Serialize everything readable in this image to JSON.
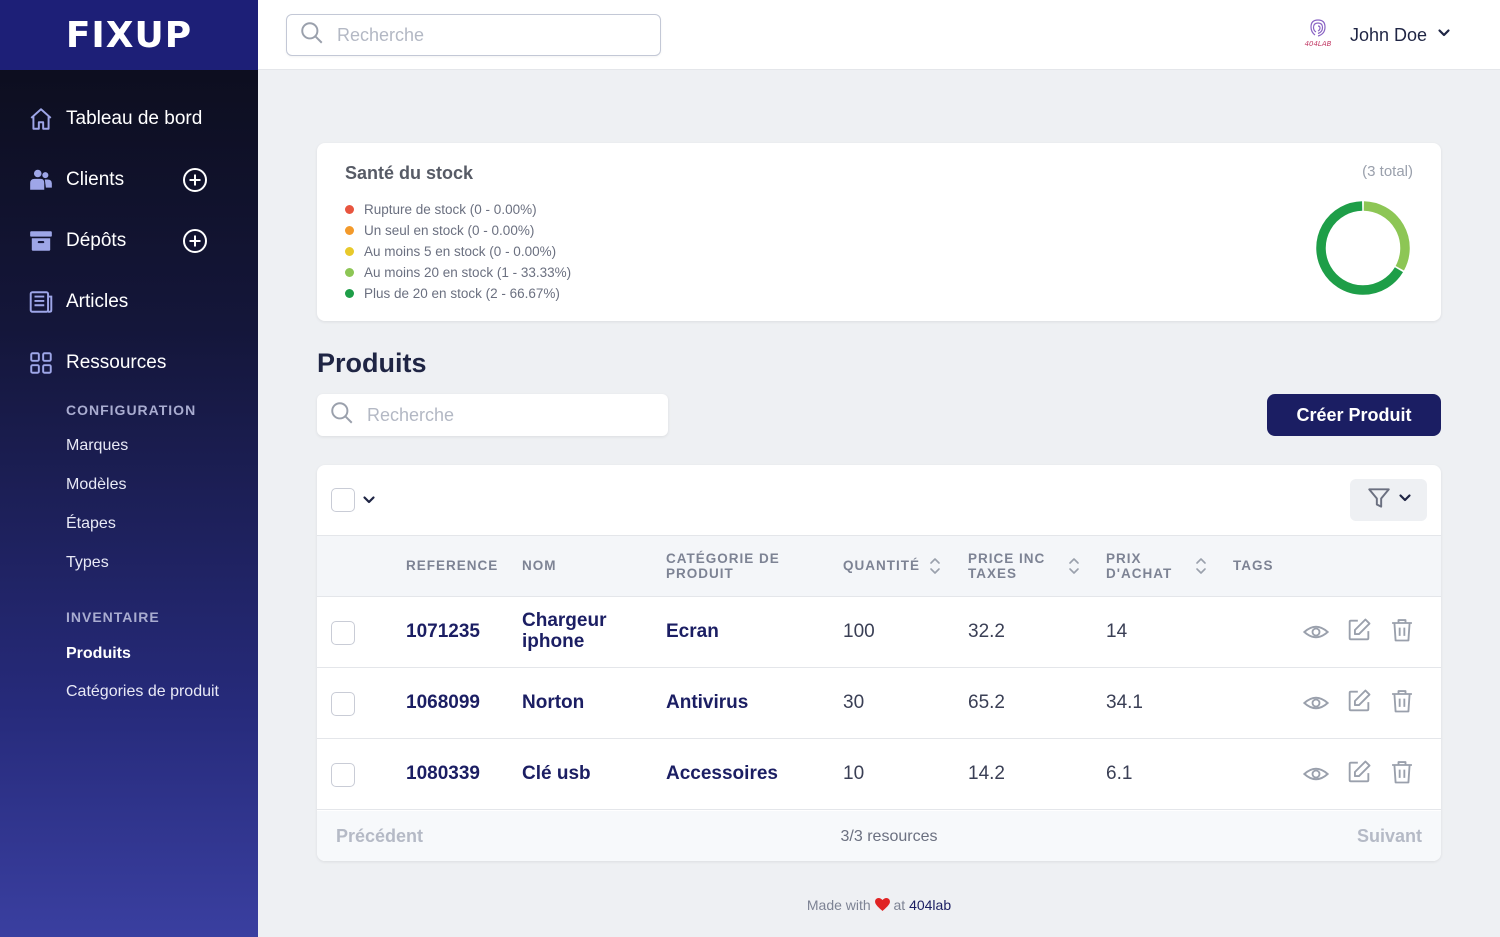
{
  "app": {
    "logo": "FIXUP"
  },
  "sidebar": {
    "items": [
      {
        "label": "Tableau de bord",
        "icon": "home-icon"
      },
      {
        "label": "Clients",
        "icon": "users-icon",
        "has_add": true
      },
      {
        "label": "Dépôts",
        "icon": "archive-icon",
        "has_add": true
      },
      {
        "label": "Articles",
        "icon": "newspaper-icon"
      },
      {
        "label": "Ressources",
        "icon": "grid-icon"
      }
    ],
    "configuration": {
      "heading": "CONFIGURATION",
      "items": [
        "Marques",
        "Modèles",
        "Étapes",
        "Types"
      ]
    },
    "inventaire": {
      "heading": "INVENTAIRE",
      "items": [
        "Produits",
        "Catégories de produit"
      ],
      "active": "Produits"
    }
  },
  "header": {
    "search_placeholder": "Recherche",
    "user_name": "John Doe",
    "avatar_text": "404LAB"
  },
  "stock": {
    "title": "Santé du stock",
    "total": "(3 total)",
    "legend": [
      {
        "label": "Rupture de stock (0 - 0.00%)",
        "color": "#e8553f"
      },
      {
        "label": "Un seul en stock (0 - 0.00%)",
        "color": "#f39a2b"
      },
      {
        "label": "Au moins 5 en stock (0 - 0.00%)",
        "color": "#e8c92b"
      },
      {
        "label": "Au moins 20 en stock (1 - 33.33%)",
        "color": "#8dc655"
      },
      {
        "label": "Plus de 20 en stock (2 - 66.67%)",
        "color": "#1e9e48"
      }
    ],
    "donut_fractions": [
      0,
      0,
      0,
      0.3333,
      0.6667
    ]
  },
  "products": {
    "title": "Produits",
    "search_placeholder": "Recherche",
    "create_label": "Créer Produit",
    "columns": {
      "reference": "REFERENCE",
      "nom": "NOM",
      "categorie_1": "CATÉGORIE DE",
      "categorie_2": "PRODUIT",
      "quantite": "QUANTITÉ",
      "price_1": "PRICE INC",
      "price_2": "TAXES",
      "achat_1": "PRIX",
      "achat_2": "D'ACHAT",
      "tags": "TAGS"
    },
    "rows": [
      {
        "reference": "1071235",
        "nom_1": "Chargeur",
        "nom_2": "iphone",
        "categorie": "Ecran",
        "quantite": "100",
        "price": "32.2",
        "achat": "14"
      },
      {
        "reference": "1068099",
        "nom_1": "Norton",
        "nom_2": "",
        "categorie": "Antivirus",
        "quantite": "30",
        "price": "65.2",
        "achat": "34.1"
      },
      {
        "reference": "1080339",
        "nom_1": "Clé usb",
        "nom_2": "",
        "categorie": "Accessoires",
        "quantite": "10",
        "price": "14.2",
        "achat": "6.1"
      }
    ],
    "pager": {
      "prev": "Précédent",
      "info": "3/3 resources",
      "next": "Suivant"
    }
  },
  "footer": {
    "made_with": "Made with",
    "at": "at",
    "lab": "404lab",
    "heart_color": "#e02424"
  }
}
